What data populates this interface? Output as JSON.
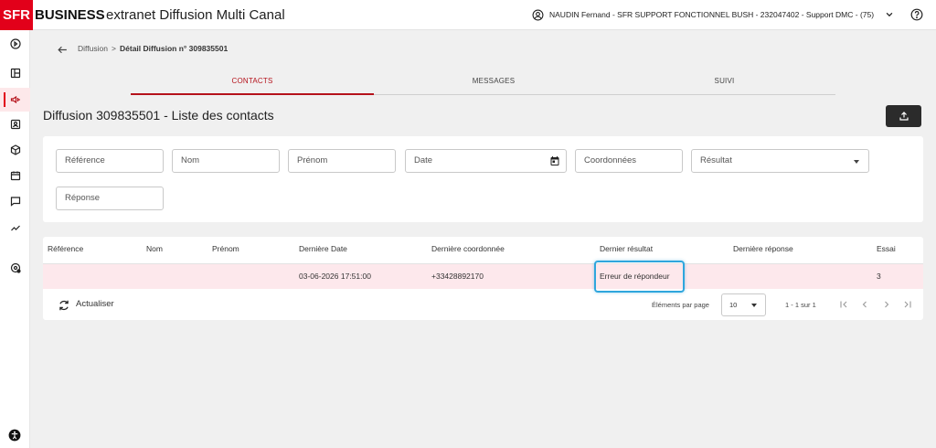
{
  "header": {
    "logo_sfr": "SFR",
    "logo_business": "BUSINESS",
    "app_title": "extranet Diffusion Multi Canal",
    "user_label": "NAUDIN Fernand - SFR SUPPORT FONCTIONNEL BUSH - 232047402 - Support DMC - (75)"
  },
  "sidebar": {
    "items": [
      {
        "icon": "play-circle-icon"
      },
      {
        "icon": "dashboard-icon"
      },
      {
        "icon": "campaign-icon",
        "active": true
      },
      {
        "icon": "contacts-icon"
      },
      {
        "icon": "package-icon"
      },
      {
        "icon": "calendar-icon"
      },
      {
        "icon": "chat-icon"
      },
      {
        "icon": "trending-icon"
      },
      {
        "icon": "settings-icon"
      }
    ]
  },
  "breadcrumb": {
    "link": "Diffusion",
    "separator": ">",
    "current": "Détail Diffusion n° 309835501"
  },
  "tabs": [
    {
      "label": "CONTACTS",
      "active": true
    },
    {
      "label": "MESSAGES",
      "active": false
    },
    {
      "label": "SUIVI",
      "active": false
    }
  ],
  "page_title": "Diffusion 309835501 - Liste des contacts",
  "filters": {
    "reference": "Référence",
    "nom": "Nom",
    "prenom": "Prénom",
    "date": "Date",
    "coordonnees": "Coordonnées",
    "resultat": "Résultat",
    "reponse": "Réponse"
  },
  "table": {
    "columns": [
      "Référence",
      "Nom",
      "Prénom",
      "Dernière Date",
      "Dernière coordonnée",
      "Dernier résultat",
      "Dernière réponse",
      "Essai"
    ],
    "rows": [
      {
        "reference": "",
        "nom": "",
        "prenom": "",
        "derniere_date": "03-06-2026 17:51:00",
        "derniere_coordonnee": "+33428892170",
        "dernier_resultat": "Erreur de répondeur",
        "derniere_reponse": "",
        "essai": "3"
      }
    ]
  },
  "footer": {
    "refresh_label": "Actualiser",
    "per_page_label": "Éléments par page",
    "per_page_value": "10",
    "range_label": "1 - 1 sur 1"
  },
  "colors": {
    "brand_red": "#e2001a",
    "tab_active": "#b5121b",
    "row_highlight": "#fde8ec",
    "focus_outline": "#2fa6dd"
  }
}
